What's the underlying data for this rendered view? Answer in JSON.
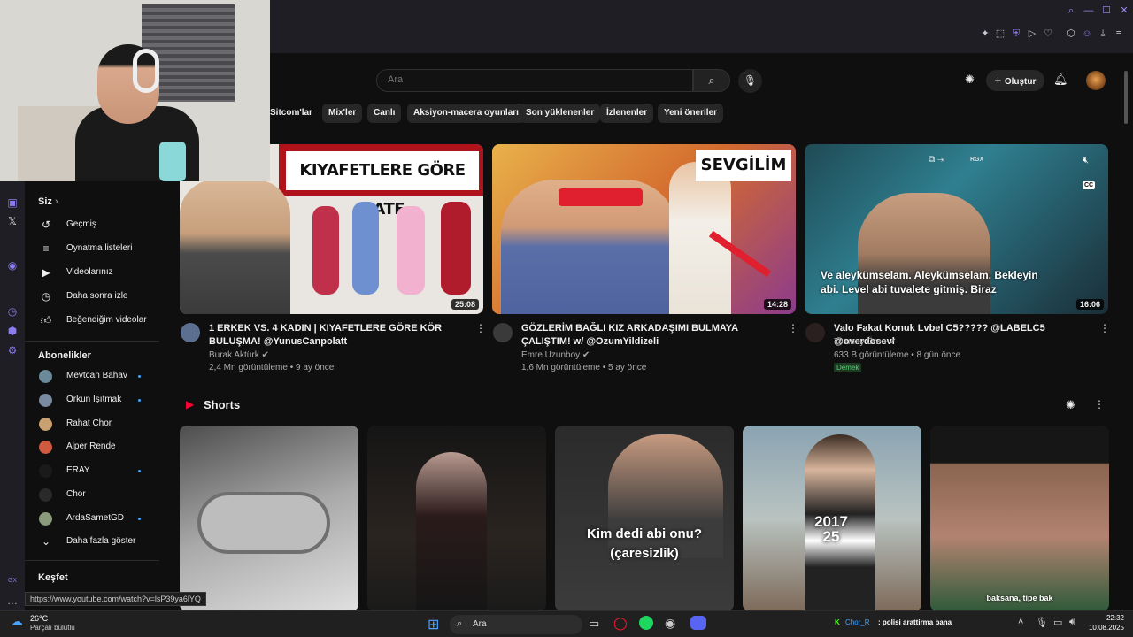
{
  "search": {
    "placeholder": "Ara"
  },
  "header": {
    "create_label": "Oluştur"
  },
  "chips": [
    "Sitcom'lar",
    "Mix'ler",
    "Canlı",
    "Aksiyon-macera oyunları",
    "Son yüklenenler",
    "İzlenenler",
    "Yeni öneriler"
  ],
  "sidebar": {
    "you_heading": "Siz",
    "you_items": [
      {
        "label": "Geçmiş",
        "icon": "history-icon"
      },
      {
        "label": "Oynatma listeleri",
        "icon": "playlist-icon"
      },
      {
        "label": "Videolarınız",
        "icon": "your-videos-icon"
      },
      {
        "label": "Daha sonra izle",
        "icon": "watch-later-icon"
      },
      {
        "label": "Beğendiğim videolar",
        "icon": "thumbs-up-icon"
      }
    ],
    "subs_heading": "Abonelikler",
    "subs": [
      {
        "label": "Mevtcan Bahav",
        "dot": true
      },
      {
        "label": "Orkun Işıtmak",
        "dot": true
      },
      {
        "label": "Rahat Chor",
        "dot": false
      },
      {
        "label": "Alper Rende",
        "dot": false
      },
      {
        "label": "ERAY",
        "dot": true
      },
      {
        "label": "Chor",
        "dot": false
      },
      {
        "label": "ArdaSametGD",
        "dot": true
      }
    ],
    "show_more": "Daha fazla göster",
    "explore_heading": "Keşfet"
  },
  "videos": [
    {
      "thumb_text": "KIYAFETLERE GÖRE DATE",
      "duration": "25:08",
      "title": "1 ERKEK VS. 4 KADIN | KIYAFETLERE GÖRE KÖR BULUŞMA! @YunusCanpolatt",
      "channel": "Burak Aktürk",
      "meta": "2,4 Mn görüntüleme • 9 ay önce"
    },
    {
      "thumb_text": "SEVGİLİM",
      "duration": "14:28",
      "title": "GÖZLERİM BAĞLI KIZ ARKADAŞIMI BULMAYA ÇALIŞTIM! w/ @OzumYildizeli",
      "channel": "Emre Uzunboy",
      "meta": "1,6 Mn görüntüleme • 5 ay önce"
    },
    {
      "thumb_caption": "Ve aleykümselam. Aleykümselam. Bekleyin abi. Level abi tuvalete gitmiş. Biraz",
      "duration": "16:06",
      "title": "Valo Fakat Konuk Lvbel C5????? @LABELC5 @overdosevl",
      "channel": "Tolunay Ören",
      "meta": "633 B görüntüleme • 8 gün önce",
      "badge": "Demek"
    }
  ],
  "shorts": {
    "heading": "Shorts",
    "items": [
      {
        "caption": ""
      },
      {
        "caption": ""
      },
      {
        "caption": "Kim dedi abi onu?\n(çaresizlik)"
      },
      {
        "caption": "2017\n25"
      },
      {
        "caption": "baksana, tipe bak"
      }
    ]
  },
  "status_bar": {
    "url": "https://www.youtube.com/watch?v=lsP39ya6lYQ"
  },
  "taskbar": {
    "weather_temp": "26°C",
    "weather_desc": "Parçalı bulutlu",
    "search_label": "Ara",
    "now_playing_user": "Chor_R",
    "now_playing_text": ": polisi arattirma bana",
    "time": "22:32",
    "date": "10.08.2025"
  },
  "colors": {
    "accent": "#8a7cf0",
    "yt_red": "#ff0033",
    "link_blue": "#3ea6ff"
  }
}
